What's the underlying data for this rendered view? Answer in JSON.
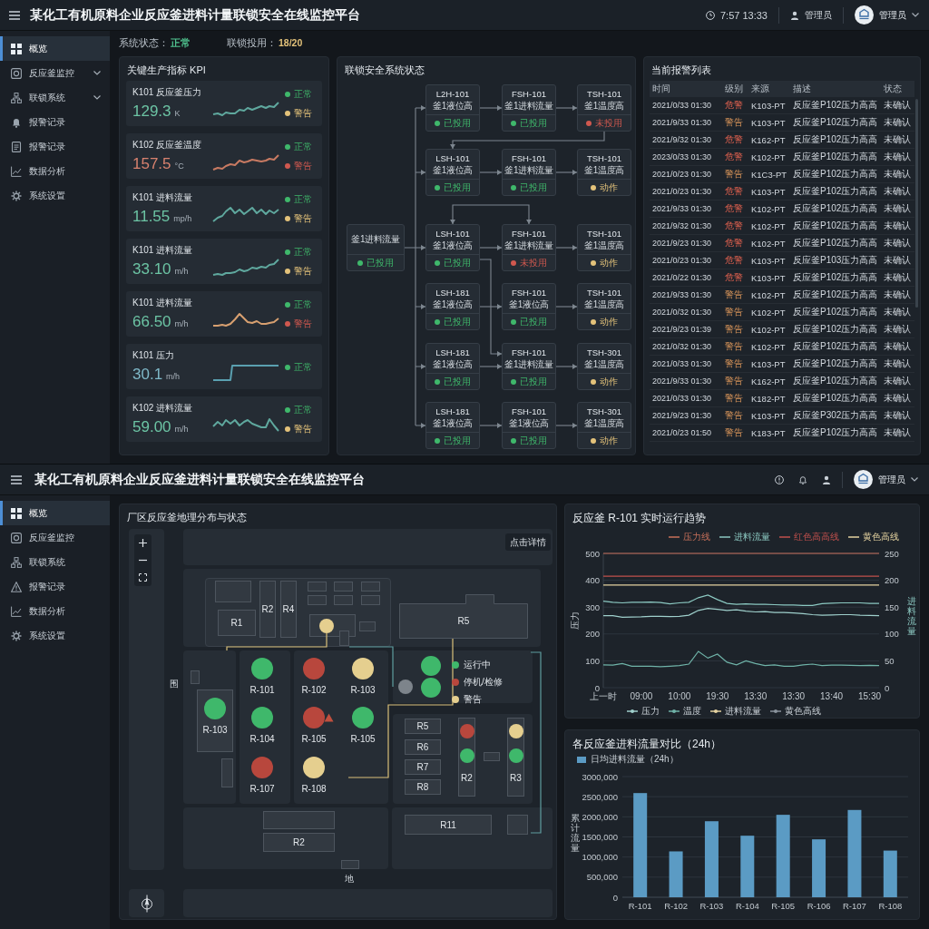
{
  "upper_screen": {
    "header": {
      "title": "某化工有机原料企业反应釜进料计量联锁安全在线监控平台",
      "clock": "7:57 13:33",
      "user": "管理员",
      "account": "管理员"
    },
    "sidebar": [
      {
        "label": "概览",
        "selected": true,
        "has_submenu": false
      },
      {
        "label": "反应釜监控",
        "selected": false,
        "has_submenu": true
      },
      {
        "label": "联锁系统",
        "selected": false,
        "has_submenu": true
      },
      {
        "label": "报警记录",
        "selected": false,
        "has_submenu": false
      },
      {
        "label": "报警记录",
        "selected": false,
        "has_submenu": false
      },
      {
        "label": "数据分析",
        "selected": false,
        "has_submenu": false
      },
      {
        "label": "系统设置",
        "selected": false,
        "has_submenu": false
      }
    ],
    "status": [
      {
        "label": "系统状态：",
        "value": "正常",
        "color": "#4fc08d"
      },
      {
        "label": "联锁投用：",
        "value": "18/20",
        "color": "#e3c27a"
      }
    ],
    "kpi_panel": {
      "title": "关键生产指标 KPI",
      "cards": [
        {
          "name": "K101 反应釜压力",
          "value": "129.3",
          "unit": "K",
          "color": "#6cc4a4",
          "trend": {
            "kind": "wave",
            "color": "#5fa89e"
          },
          "statuses": [
            {
              "label": "正常",
              "color": "#3fb86b"
            },
            {
              "label": "警告",
              "color": "#e3c27a"
            }
          ]
        },
        {
          "name": "K102 反应釜温度",
          "value": "157.5",
          "unit": "°C",
          "color": "#d9826f",
          "trend": {
            "kind": "wave",
            "color": "#c87a62"
          },
          "statuses": [
            {
              "label": "正常",
              "color": "#3fb86b"
            },
            {
              "label": "警告",
              "color": "#d0584f"
            }
          ]
        },
        {
          "name": "K101 进料流量",
          "value": "11.55",
          "unit": "mp/h",
          "color": "#6cc4a4",
          "trend": {
            "kind": "wave",
            "color": "#5fa89e"
          },
          "statuses": [
            {
              "label": "正常",
              "color": "#3fb86b"
            },
            {
              "label": "警告",
              "color": "#e3c27a"
            }
          ]
        },
        {
          "name": "K101 进料流量",
          "value": "33.10",
          "unit": "m/h",
          "color": "#6cc4a4",
          "trend": {
            "kind": "wave",
            "color": "#5fa89e"
          },
          "statuses": [
            {
              "label": "正常",
              "color": "#3fb86b"
            },
            {
              "label": "警告",
              "color": "#e3c27a"
            }
          ]
        },
        {
          "name": "K101 进料流量",
          "value": "66.50",
          "unit": "m/h",
          "color": "#6cc4a4",
          "trend": {
            "kind": "wave",
            "color": "#d8a070"
          },
          "statuses": [
            {
              "label": "正常",
              "color": "#3fb86b"
            },
            {
              "label": "警告",
              "color": "#d0584f"
            }
          ]
        },
        {
          "name": "K101 压力",
          "value": "30.1",
          "unit": "m/h",
          "color": "#7fb8c8",
          "trend": {
            "kind": "step",
            "color": "#5aa0b0"
          },
          "statuses": [
            {
              "label": "正常",
              "color": "#3fb86b"
            }
          ]
        },
        {
          "name": "K102 进料流量",
          "value": "59.00",
          "unit": "m/h",
          "color": "#6cc4a4",
          "trend": {
            "kind": "wave",
            "color": "#5fa89e"
          },
          "statuses": [
            {
              "label": "正常",
              "color": "#3fb86b"
            },
            {
              "label": "警告",
              "color": "#e3c27a"
            }
          ]
        }
      ]
    },
    "interlock_panel": {
      "title": "联锁安全系统状态",
      "source": {
        "name": "釜1进料流量",
        "status": "已投用",
        "color": "#3fb86b"
      },
      "rows": [
        [
          {
            "tag": "L2H-101",
            "desc": "釜1液位高",
            "status": "已投用",
            "color": "#3fb86b"
          },
          {
            "tag": "FSH-101",
            "desc": "釜1进料流量",
            "status": "已投用",
            "color": "#3fb86b"
          },
          {
            "tag": "TSH-101",
            "desc": "釜1温度高",
            "status": "未投用",
            "color": "#d0584f"
          }
        ],
        [
          {
            "tag": "LSH-101",
            "desc": "釜1液位高",
            "status": "已投用",
            "color": "#3fb86b"
          },
          {
            "tag": "FSH-101",
            "desc": "釜1进料流量",
            "status": "已投用",
            "color": "#3fb86b"
          },
          {
            "tag": "TSH-101",
            "desc": "釜1温度高",
            "status": "动作",
            "color": "#e3c27a"
          }
        ],
        [
          {
            "tag": "LSH-101",
            "desc": "釜1液位高",
            "status": "已投用",
            "color": "#3fb86b"
          },
          {
            "tag": "FSH-101",
            "desc": "釜1进料流量",
            "status": "未投用",
            "color": "#d0584f"
          },
          {
            "tag": "TSH-101",
            "desc": "釜1温度高",
            "status": "动作",
            "color": "#e3c27a"
          }
        ],
        [
          {
            "tag": "LSH-181",
            "desc": "釜1液位高",
            "status": "已投用",
            "color": "#3fb86b"
          },
          {
            "tag": "FSH-101",
            "desc": "釜1液位高",
            "status": "已投用",
            "color": "#3fb86b"
          },
          {
            "tag": "TSH-101",
            "desc": "釜1温度高",
            "status": "动作",
            "color": "#e3c27a"
          }
        ],
        [
          {
            "tag": "LSH-181",
            "desc": "釜1液位高",
            "status": "已投用",
            "color": "#3fb86b"
          },
          {
            "tag": "FSH-101",
            "desc": "釜1进料流量",
            "status": "已投用",
            "color": "#3fb86b"
          },
          {
            "tag": "TSH-301",
            "desc": "釜1温度高",
            "status": "动作",
            "color": "#e3c27a"
          }
        ],
        [
          {
            "tag": "LSH-181",
            "desc": "釜1液位高",
            "status": "已投用",
            "color": "#3fb86b"
          },
          {
            "tag": "FSH-101",
            "desc": "釜1液位高",
            "status": "已投用",
            "color": "#3fb86b"
          },
          {
            "tag": "TSH-301",
            "desc": "釜1温度高",
            "status": "动作",
            "color": "#e3c27a"
          }
        ]
      ]
    },
    "alarm_panel": {
      "title": "当前报警列表",
      "columns": [
        "时间",
        "级别",
        "来源",
        "描述",
        "状态"
      ],
      "rows": [
        {
          "time": "2021/0/33 01:30",
          "level": "危警",
          "kind": "critical",
          "source": "K103-PT",
          "description": "反应釜P102压力高高",
          "status": "未确认"
        },
        {
          "time": "2021/9/33 01:30",
          "level": "警告",
          "kind": "warning",
          "source": "K103-PT",
          "description": "反应釜P102压力高高",
          "status": "未确认"
        },
        {
          "time": "2021/9/32 01:30",
          "level": "危警",
          "kind": "critical",
          "source": "K162-PT",
          "description": "反应釜P102压力高高",
          "status": "未确认"
        },
        {
          "time": "2023/0/33 01:30",
          "level": "危警",
          "kind": "critical",
          "source": "K102-PT",
          "description": "反应釜P102压力高高",
          "status": "未确认"
        },
        {
          "time": "2021/0/23 01:30",
          "level": "警告",
          "kind": "warning",
          "source": "K1C3-PT",
          "description": "反应釜P102压力高高",
          "status": "未确认"
        },
        {
          "time": "2021/0/23 01:30",
          "level": "危警",
          "kind": "critical",
          "source": "K103-PT",
          "description": "反应釜P102压力高高",
          "status": "未确认"
        },
        {
          "time": "2021/9/33 01:30",
          "level": "危警",
          "kind": "critical",
          "source": "K102-PT",
          "description": "反应釜P102压力高高",
          "status": "未确认"
        },
        {
          "time": "2021/9/32 01:30",
          "level": "危警",
          "kind": "critical",
          "source": "K102-PT",
          "description": "反应釜P102压力高高",
          "status": "未确认"
        },
        {
          "time": "2021/9/23 01:30",
          "level": "危警",
          "kind": "critical",
          "source": "K102-PT",
          "description": "反应釜P102压力高高",
          "status": "未确认"
        },
        {
          "time": "2021/0/23 01:30",
          "level": "危警",
          "kind": "critical",
          "source": "K103-PT",
          "description": "反应釜P103压力高高",
          "status": "未确认"
        },
        {
          "time": "2021/0/22 01:30",
          "level": "危警",
          "kind": "critical",
          "source": "K103-PT",
          "description": "反应釜P102压力高高",
          "status": "未确认"
        },
        {
          "time": "2021/9/33 01:30",
          "level": "警告",
          "kind": "warning",
          "source": "K102-PT",
          "description": "反应釜P102压力高高",
          "status": "未确认"
        },
        {
          "time": "2021/0/32 01:30",
          "level": "警告",
          "kind": "warning",
          "source": "K102-PT",
          "description": "反应釜P102压力高高",
          "status": "未确认"
        },
        {
          "time": "2021/9/23 01:39",
          "level": "警告",
          "kind": "warning",
          "source": "K102-PT",
          "description": "反应釜P102压力高高",
          "status": "未确认"
        },
        {
          "time": "2021/0/32 01:30",
          "level": "警告",
          "kind": "warning",
          "source": "K102-PT",
          "description": "反应釜P102压力高高",
          "status": "未确认"
        },
        {
          "time": "2021/0/33 01:30",
          "level": "警告",
          "kind": "warning",
          "source": "K103-PT",
          "description": "反应釜P102压力高高",
          "status": "未确认"
        },
        {
          "time": "2021/9/33 01:30",
          "level": "警告",
          "kind": "warning",
          "source": "K162-PT",
          "description": "反应釜P102压力高高",
          "status": "未确认"
        },
        {
          "time": "2021/0/33 01:30",
          "level": "警告",
          "kind": "warning",
          "source": "K182-PT",
          "description": "反应釜P102压力高高",
          "status": "未确认"
        },
        {
          "time": "2021/9/23 01:30",
          "level": "警告",
          "kind": "warning",
          "source": "K103-PT",
          "description": "反应釜P302压力高高",
          "status": "未确认"
        },
        {
          "time": "2021/0/23 01:50",
          "level": "警告",
          "kind": "warning",
          "source": "K183-PT",
          "description": "反应釜P102压力高高",
          "status": "未确认"
        }
      ]
    }
  },
  "lower_screen": {
    "header": {
      "title": "某化工有机原料企业反应釜进料计量联锁安全在线监控平台",
      "account": "管理员"
    },
    "sidebar": [
      {
        "label": "概览",
        "selected": true
      },
      {
        "label": "反应釜监控",
        "selected": false
      },
      {
        "label": "联锁系统",
        "selected": false
      },
      {
        "label": "报警记录",
        "selected": false
      },
      {
        "label": "数据分析",
        "selected": false
      },
      {
        "label": "系统设置",
        "selected": false
      }
    ],
    "map_panel": {
      "title": "厂区反应釜地理分布与状态",
      "detail_button": "点击详情",
      "buildings": [
        {
          "label": "R1",
          "kind": "block"
        },
        {
          "label": "R2",
          "kind": "block"
        },
        {
          "label": "R4",
          "kind": "block"
        },
        {
          "label": "R5",
          "kind": "hall"
        },
        {
          "label": "R5",
          "kind": "block"
        },
        {
          "label": "R6",
          "kind": "block"
        },
        {
          "label": "R7",
          "kind": "block"
        },
        {
          "label": "R8",
          "kind": "block"
        },
        {
          "label": "R11",
          "kind": "block"
        },
        {
          "label": "R2",
          "kind": "block"
        }
      ],
      "reactors": [
        {
          "name": "R-101",
          "color": "#3fb86b",
          "warning": false
        },
        {
          "name": "R-102",
          "color": "#b8473d",
          "warning": false
        },
        {
          "name": "R-103",
          "color": "#e5cf8f",
          "warning": false
        },
        {
          "name": "R-103",
          "color": "#3fb86b",
          "warning": false
        },
        {
          "name": "R-104",
          "color": "#3fb86b",
          "warning": false
        },
        {
          "name": "R-105",
          "color": "#b8473d",
          "warning": true
        },
        {
          "name": "R-105",
          "color": "#3fb86b",
          "warning": false
        },
        {
          "name": "R-107",
          "color": "#b8473d",
          "warning": false
        },
        {
          "name": "R-108",
          "color": "#e5cf8f",
          "warning": false
        }
      ],
      "lights": [
        {
          "color": "#e5cf8f"
        },
        {
          "color": "#7d848b"
        },
        {
          "color": "#3fb86b"
        },
        {
          "color": "#3fb86b"
        }
      ],
      "columns": [
        {
          "label": "R2",
          "lights": [
            {
              "color": "#b8473d"
            },
            {
              "color": "#3fb86b"
            }
          ]
        },
        {
          "label": "R3",
          "lights": [
            {
              "color": "#e5cf8f"
            },
            {
              "color": "#3fb86b"
            }
          ]
        }
      ],
      "legend": [
        {
          "label": "运行中",
          "color": "#3fb86b"
        },
        {
          "label": "停机/检修",
          "color": "#b8473d"
        },
        {
          "label": "警告",
          "color": "#e5cf8f"
        }
      ],
      "labels": [
        "围",
        "地"
      ]
    },
    "trend_panel": {
      "chart_data": {
        "type": "line",
        "title": "反应釜 R-101 实时运行趋势",
        "ylabel": "压力",
        "grid": true,
        "categories": [
          "上一时",
          null,
          null,
          null,
          "09:00",
          null,
          null,
          null,
          "10:00",
          null,
          null,
          null,
          "19:30",
          null,
          null,
          null,
          "13:30",
          null,
          null,
          null,
          "13:30",
          null,
          null,
          null,
          "13:40",
          null,
          null,
          null,
          "15:30",
          null
        ],
        "ylim": [
          0,
          500
        ],
        "yticks": [
          0,
          100,
          200,
          300,
          400,
          500
        ],
        "series": [
          {
            "name": "压力线",
            "color": "#c8705a",
            "values": [
              500,
              500,
              500,
              500,
              500,
              500,
              500,
              500,
              500,
              500,
              500,
              500,
              500,
              500,
              500,
              500,
              500,
              500,
              500,
              500,
              500,
              500,
              500,
              500,
              500,
              500,
              500,
              500,
              500,
              500
            ]
          },
          {
            "name": "进料流量",
            "color": "#8cc9c2",
            "values": [
              322,
              318,
              316,
              318,
              318,
              319,
              317,
              312,
              316,
              318,
              335,
              345,
              328,
              314,
              310,
              312,
              310,
              310,
              309,
              308,
              308,
              306,
              306,
              313,
              315,
              316,
              316,
              316,
              314,
              314
            ]
          },
          {
            "name": "红色高高线",
            "color": "#c0504d",
            "values": [
              415,
              415,
              415,
              415,
              415,
              415,
              415,
              415,
              415,
              415,
              415,
              415,
              415,
              415,
              415,
              415,
              415,
              415,
              415,
              415,
              415,
              415,
              415,
              415,
              415,
              415,
              415,
              415,
              415,
              415
            ]
          },
          {
            "name": "黄色高线",
            "color": "#e5d3a0",
            "values": [
              382,
              382,
              382,
              382,
              382,
              382,
              382,
              382,
              382,
              382,
              382,
              382,
              382,
              382,
              382,
              382,
              382,
              382,
              382,
              382,
              382,
              382,
              382,
              382,
              382,
              382,
              382,
              382,
              382,
              382
            ]
          },
          {
            "name": "压力",
            "color": "#9fd0cc",
            "values": [
              268,
              268,
              262,
              263,
              264,
              266,
              266,
              265,
              266,
              270,
              288,
              295,
              292,
              288,
              290,
              285,
              282,
              283,
              280,
              280,
              278,
              276,
              272,
              270,
              271,
              272,
              272,
              270,
              269,
              268
            ]
          },
          {
            "name": "温度",
            "color": "#6fb3a8",
            "values": [
              85,
              84,
              90,
              80,
              80,
              80,
              78,
              80,
              82,
              88,
              135,
              110,
              125,
              95,
              85,
              100,
              90,
              82,
              85,
              80,
              80,
              85,
              88,
              82,
              84,
              84,
              83,
              82,
              83,
              82
            ]
          }
        ]
      },
      "right_axis": {
        "label": "进料流量",
        "ticks": [
          "250",
          "200",
          "150",
          "100",
          "50",
          "0"
        ]
      },
      "legend_extra": [
        {
          "label": "进料流量",
          "color": "#e5d3a0"
        },
        {
          "label": "黄色高线",
          "color": "#8a939c"
        }
      ]
    },
    "flow_panel": {
      "chart_data": {
        "type": "bar",
        "title": "各反应釜进料流量对比（24h）",
        "ylabel": "累计流量",
        "grid": true,
        "categories": [
          "R-101",
          "R-102",
          "R-103",
          "R-104",
          "R-105",
          "R-106",
          "R-107",
          "R-108"
        ],
        "ylim": [
          0,
          3000000
        ],
        "yticks": [
          {
            "value": 0,
            "label": "0"
          },
          {
            "value": 500000,
            "label": "500,000"
          },
          {
            "value": 1000000,
            "label": "1000,000"
          },
          {
            "value": 1500000,
            "label": "1500,000"
          },
          {
            "value": 2000000,
            "label": "2000,000"
          },
          {
            "value": 2500000,
            "label": "2500,000"
          },
          {
            "value": 3000000,
            "label": "3000,000"
          }
        ],
        "series": [
          {
            "name": "日均进料流量（24h）",
            "color": "#5b9bc4",
            "values": [
              2590000,
              1140000,
              1890000,
              1530000,
              2050000,
              1440000,
              2170000,
              1160000
            ]
          }
        ]
      }
    }
  }
}
